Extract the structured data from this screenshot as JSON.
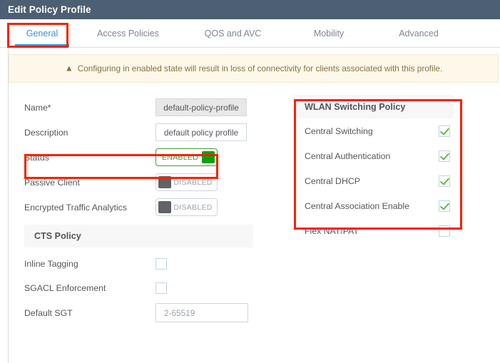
{
  "window": {
    "title": "Edit Policy Profile"
  },
  "tabs": [
    {
      "label": "General",
      "active": true
    },
    {
      "label": "Access Policies",
      "active": false
    },
    {
      "label": "QOS and AVC",
      "active": false
    },
    {
      "label": "Mobility",
      "active": false
    },
    {
      "label": "Advanced",
      "active": false
    }
  ],
  "banner": {
    "icon": "warning-triangle-icon",
    "text": "Configuring in enabled state will result in loss of connectivity for clients associated with this profile."
  },
  "general": {
    "name": {
      "label": "Name*",
      "value": "default-policy-profile",
      "disabled": true
    },
    "description": {
      "label": "Description",
      "value": "default policy profile",
      "disabled": false
    },
    "status": {
      "label": "Status",
      "state": "ENABLED",
      "on": true
    },
    "passive_client": {
      "label": "Passive Client",
      "state": "DISABLED",
      "on": false
    },
    "encrypted_traffic_analytics": {
      "label": "Encrypted Traffic Analytics",
      "state": "DISABLED",
      "on": false
    }
  },
  "cts_policy": {
    "title": "CTS Policy",
    "inline_tagging": {
      "label": "Inline Tagging",
      "checked": false
    },
    "sgacl_enforcement": {
      "label": "SGACL Enforcement",
      "checked": false
    },
    "default_sgt": {
      "label": "Default SGT",
      "placeholder": "2-65519",
      "value": ""
    }
  },
  "wlan_switching_policy": {
    "title": "WLAN Switching Policy",
    "items": [
      {
        "label": "Central Switching",
        "checked": true
      },
      {
        "label": "Central Authentication",
        "checked": true
      },
      {
        "label": "Central DHCP",
        "checked": true
      },
      {
        "label": "Central Association Enable",
        "checked": true
      }
    ],
    "flex_nat_pat": {
      "label": "Flex NAT/PAT",
      "checked": false
    }
  },
  "colors": {
    "titlebar": "#4c5f73",
    "tab_active": "#3a8fd4",
    "tab_underline": "#27a1dd",
    "banner_bg": "#fdf8e9",
    "banner_text": "#8a7042",
    "toggle_on": "#00a40c",
    "toggle_off": "#5f6266",
    "check": "#62bb46",
    "annotation": "#fb2000"
  }
}
